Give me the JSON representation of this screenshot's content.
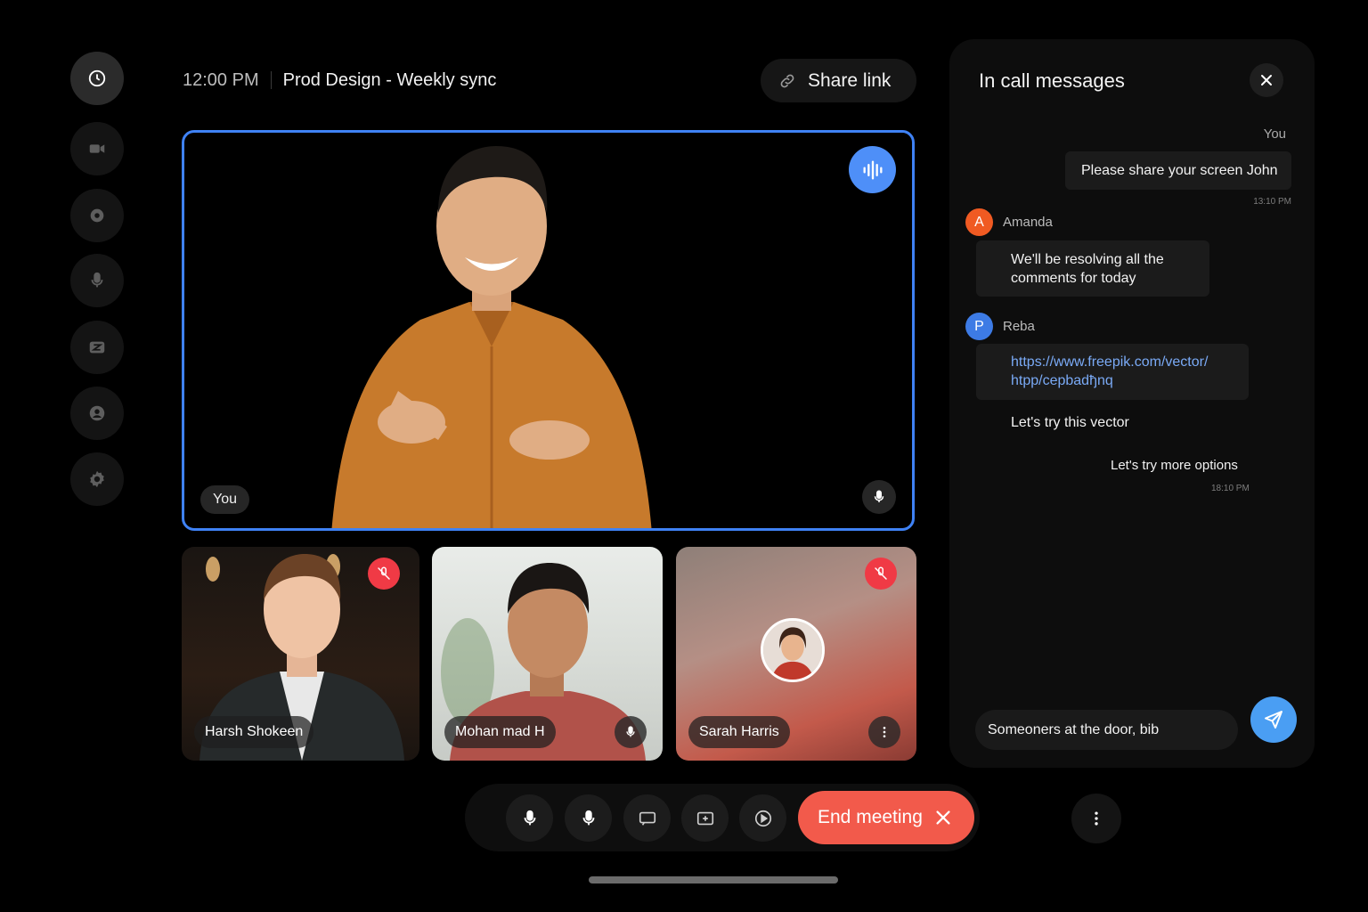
{
  "header": {
    "time": "12:00 PM",
    "meeting_title": "Prod Design - Weekly sync",
    "share_label": "Share link"
  },
  "sidebar": {
    "items": [
      {
        "icon": "clock-icon",
        "active": true
      },
      {
        "icon": "video-icon"
      },
      {
        "icon": "record-icon"
      },
      {
        "icon": "mic-icon"
      },
      {
        "icon": "captions-icon"
      },
      {
        "icon": "user-icon"
      },
      {
        "icon": "gear-icon"
      }
    ]
  },
  "main_tile": {
    "label": "You",
    "speaking": true,
    "border_color": "#3f82f5"
  },
  "participants": [
    {
      "name": "Harsh Shokeen",
      "muted": true
    },
    {
      "name": "Mohan mad H",
      "muted": false
    },
    {
      "name": "Sarah Harris",
      "muted": true,
      "video_off": true
    }
  ],
  "chat": {
    "title": "In call messages",
    "messages": [
      {
        "sender": "You",
        "text": "Please share your screen John",
        "time": "13:10 PM"
      },
      {
        "sender": "Amanda",
        "initial": "A",
        "text": "We'll be resolving all the comments for today"
      },
      {
        "sender": "Reba",
        "initial": "P",
        "link_line1": "https://www.freepik.com/vector/",
        "link_line2": "htpp/cepbadђnq",
        "text2": "Let's try this vector",
        "text3": "Let's try more options",
        "time": "18:10 PM"
      }
    ],
    "input_value": "Someoners at the door, bib"
  },
  "controls": {
    "end_label": "End meeting"
  },
  "colors": {
    "accent": "#3f82f5",
    "end": "#f25a4b",
    "mute": "#f03a45",
    "send": "#4a9ef3"
  }
}
